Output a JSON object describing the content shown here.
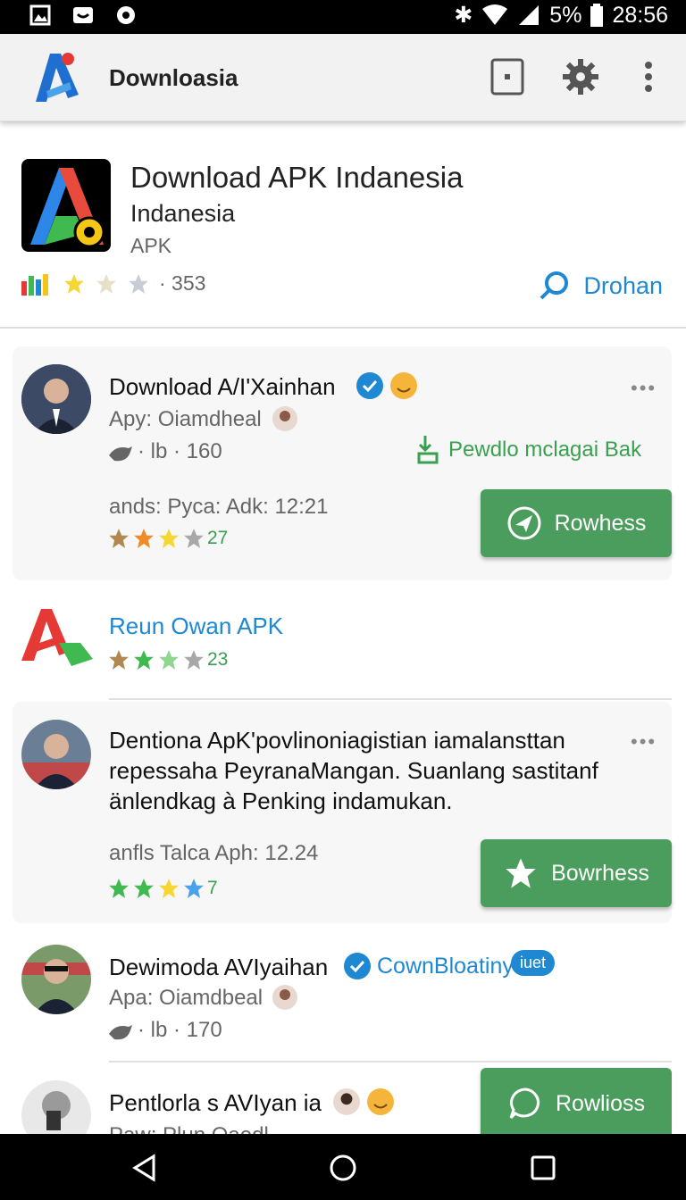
{
  "status": {
    "battery": "5%",
    "time": "28:56"
  },
  "appbar": {
    "title": "Downloasia"
  },
  "hero": {
    "title": "Download APK Indanesia",
    "subtitle": "Indanesia",
    "type": "APK",
    "rating_count": "· 353",
    "download_label": "Drohan"
  },
  "items": [
    {
      "name": "Download A/I'Xainhan",
      "sub1": "Apy: Oiamdheal",
      "sub2": "· lb · 160",
      "meta": "ands: Pyca: Adk: 12:21",
      "rating": "27",
      "side_link": "Pewdlo mclagai Bak",
      "button": "Rowhess"
    },
    {
      "name": "Reun Owan APK",
      "rating": "23"
    },
    {
      "name": "Dentiona ApK'povlinoniagistian iamalansttan",
      "line2": "repessaha PeyranaMangan. Suanlang sastitanf",
      "line3": "änlendkag à Penking indamukan.",
      "meta": "anfls Talca Aph: 12.24",
      "rating": "7",
      "button": "Bowrhess"
    },
    {
      "name": "Dewimoda AVIyaihan",
      "verified_label": "CownBloatiny",
      "badge": "iuet",
      "sub1": "Apa: Oiamdbeal",
      "sub2": "· lb · 170"
    },
    {
      "name": "Pentlorla s AVIyan ia",
      "sub1": "Paw: Plun Qaedl",
      "button": "Rowlioss"
    }
  ]
}
